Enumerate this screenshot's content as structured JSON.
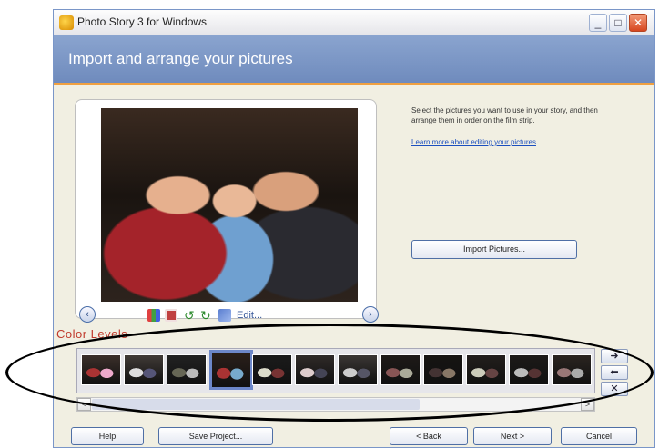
{
  "window": {
    "title": "Photo Story 3 for Windows",
    "min_glyph": "_",
    "max_glyph": "□",
    "close_glyph": "✕"
  },
  "banner": {
    "title": "Import and arrange your pictures"
  },
  "preview": {
    "edit_label": "Edit...",
    "color_levels_label": "Color Levels",
    "prev_glyph": "‹",
    "next_glyph": "›"
  },
  "sidepanel": {
    "instructions": "Select the pictures you want to use in your story, and then arrange them in order on the film strip.",
    "learn_link": "Learn more about editing your pictures",
    "import_button": "Import Pictures..."
  },
  "filmstrip": {
    "thumb_count": 12,
    "selected_index": 3,
    "move_right_glyph": "➜",
    "move_left_glyph": "⬅",
    "remove_glyph": "✕",
    "scroll_left_glyph": "<",
    "scroll_right_glyph": ">"
  },
  "footer": {
    "help": "Help",
    "save_project": "Save Project...",
    "back": "< Back",
    "next": "Next >",
    "cancel": "Cancel"
  },
  "colors": {
    "banner": "#7a94c6",
    "accent_orange": "#f0a040",
    "link": "#1b4fbf",
    "color_levels_text": "#c0392b"
  }
}
